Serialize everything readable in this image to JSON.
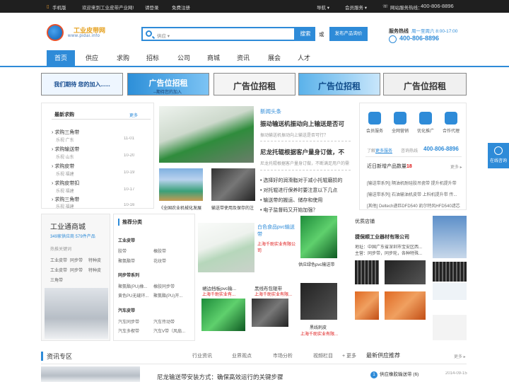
{
  "topbar": {
    "mobile": "手机版",
    "welcome": "欢迎来到工业皮带产业网!",
    "login": "请登录",
    "register": "免费注册",
    "nav": "导航 ▾",
    "member": "会员服务 ▾",
    "hotline_label": "网站服务热线：",
    "hotline": "400-806-8896"
  },
  "logo": {
    "name": "工业皮带网",
    "url": "www.pidai.info"
  },
  "search": {
    "placeholder": "供应 ▾",
    "button": "搜索",
    "or": "或",
    "publish": "发布产品询价"
  },
  "service": {
    "label": "服务热线",
    "hours": "周一至周六 8:00-17:00",
    "phone": "400-806-8896"
  },
  "nav": [
    "首页",
    "供应",
    "求购",
    "招标",
    "公司",
    "商城",
    "资讯",
    "展会",
    "人才"
  ],
  "ads": [
    {
      "text": "我们期待 您的加入......"
    },
    {
      "text": "广告位招租",
      "sub": "--期待您的加入"
    },
    {
      "text": "广告位招租"
    },
    {
      "text": "广告位招租"
    },
    {
      "text": "广告位招租"
    }
  ],
  "buy": {
    "title": "最新求购",
    "more": "更多",
    "items": [
      {
        "name": "求购三角带",
        "loc": "乐视  广东",
        "date": "11-01"
      },
      {
        "name": "求购输送带",
        "loc": "乐视  山东",
        "date": "10-20"
      },
      {
        "name": "求购皮带",
        "loc": "乐视  福建",
        "date": "10-19"
      },
      {
        "name": "求购皮带扣",
        "loc": "乐视  福建",
        "date": "10-17"
      },
      {
        "name": "求购三角带",
        "loc": "乐视  福建",
        "date": "10-16"
      }
    ]
  },
  "feature": {
    "caption1": "《全国农业机械化发展",
    "caption2": "输送带使用及保存的注"
  },
  "headlines": {
    "title": "新闻头条",
    "h1": "振动输送机振动向上输送是否可",
    "h1sub": "振动输送机振动向上输送是否可行？",
    "h2": "尼龙托辊根据客户量身订做，不",
    "h2sub": "尼龙托辊根据客户量身订做，不断满足用户的需",
    "list": [
      "选择好的润滑脂对于减小托辊磨损的",
      "对托辊进行保养时要注意以下几点",
      "输送带的搬运、储存和使用",
      "电子监督码又开始加强？"
    ]
  },
  "services": {
    "items": [
      "会员服务",
      "全网营销",
      "优化推广",
      "合作代理"
    ],
    "learn": "了解",
    "more_service": "更多服务",
    "consult": "咨询热线",
    "phone": "400-806-8896",
    "new_products_label": "近日新增产品数量",
    "new_products_count": "18",
    "more": "更多 ▸",
    "list": [
      "[输送带系列] 隔油机耐硅胶吊瓷带 提升机提升带",
      "[输送带系列] 石油输油机皮带 上料机提升带 传...",
      "[其他] Deltech递匹DFD540 凯尔特风HFD540滤芯"
    ]
  },
  "mall": {
    "title": "工业通商城",
    "counts": "349家供应商  579件产品",
    "hot": "热推关键词",
    "keywords": [
      [
        "工业皮带",
        "同步带",
        "特种皮"
      ],
      [
        "工业皮带",
        "同步带",
        "特种皮"
      ],
      [
        "三角带"
      ]
    ]
  },
  "category": {
    "title": "推荐分类",
    "groups": [
      {
        "name": "工业皮带",
        "items": [
          "胶带",
          "橡胶带",
          "聚氨酯带",
          "花纹带"
        ]
      },
      {
        "name": "同步带系列",
        "items": [
          "聚氨酯(PU)橡...",
          "橡胶同步带",
          "黄色PU无缝环...",
          "聚氨酯(PU)开..."
        ]
      },
      {
        "name": "汽车皮带",
        "items": [
          "汽车同步带",
          "汽车传动带",
          "汽车多楔带",
          "汽车V带（风扇..."
        ]
      }
    ]
  },
  "products": [
    {
      "name": "白色食品pvc输送带",
      "company": "上海千助实业有限公司"
    },
    {
      "name": "供应绿色pvc输送带",
      "company": ""
    },
    {
      "name": "裙边挡板pvc输...",
      "company": "上海千助实业有..."
    },
    {
      "name": "黑线布包辊带",
      "company": "上海千助实业有限..."
    },
    {
      "name": "黑线刺皮",
      "company": "上海千助实业有限..."
    }
  ],
  "shop": {
    "title": "优质店铺",
    "name": "捷保顺工业器材有限公司",
    "addr": "地址：中国广东省深圳市宝安区西...",
    "biz": "主营：同步带，同步轮，各种特殊..."
  },
  "news_tabs": {
    "title": "资讯专区",
    "tabs": [
      "行业资讯",
      "业界观点",
      "市场分析",
      "视频栏目"
    ],
    "more": "+ 更多",
    "article": "尼龙输送带安装方式：确保高效运行的关键步骤"
  },
  "recommend": {
    "title": "最新供应推荐",
    "more": "更多 ▸",
    "item": "供应橡胶输送带 (6)",
    "date": "2014-09-15"
  },
  "sidebar": {
    "chat": "在线咨询"
  }
}
